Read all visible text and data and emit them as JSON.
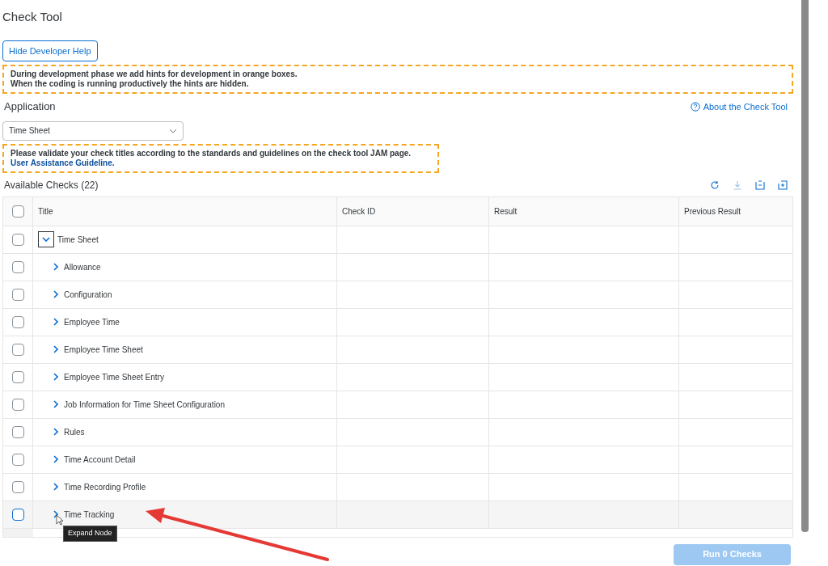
{
  "page_title": "Check Tool",
  "developer_help_button": "Hide Developer Help",
  "hints": [
    {
      "lines": [
        "During development phase we add hints for development in orange boxes.",
        "When the coding is running productively the hints are hidden."
      ]
    }
  ],
  "application": {
    "label": "Application",
    "value": "Time Sheet",
    "about_link": "About the Check Tool"
  },
  "guideline_hint": {
    "text": "Please validate your check titles according to the standards and guidelines on the check tool JAM page.",
    "link": "User Assistance Guideline."
  },
  "table": {
    "title": "Available Checks (22)",
    "select_all_checked": false,
    "columns": [
      "Title",
      "Check ID",
      "Result",
      "Previous Result"
    ],
    "rows": [
      {
        "title": "Time Sheet",
        "expanded": true,
        "checked": false,
        "hovered": false,
        "children": [
          {
            "title": "Allowance",
            "expanded": false,
            "checked": false,
            "hovered": false
          },
          {
            "title": "Configuration",
            "expanded": false,
            "checked": false,
            "hovered": false
          },
          {
            "title": "Employee Time",
            "expanded": false,
            "checked": false,
            "hovered": false
          },
          {
            "title": "Employee Time Sheet",
            "expanded": false,
            "checked": false,
            "hovered": false
          },
          {
            "title": "Employee Time Sheet Entry",
            "expanded": false,
            "checked": false,
            "hovered": false
          },
          {
            "title": "Job Information for Time Sheet Configuration",
            "expanded": false,
            "checked": false,
            "hovered": false
          },
          {
            "title": "Rules",
            "expanded": false,
            "checked": false,
            "hovered": false
          },
          {
            "title": "Time Account Detail",
            "expanded": false,
            "checked": false,
            "hovered": false
          },
          {
            "title": "Time Recording Profile",
            "expanded": false,
            "checked": false,
            "hovered": false
          },
          {
            "title": "Time Tracking",
            "expanded": false,
            "checked": false,
            "hovered": true
          }
        ]
      }
    ]
  },
  "tooltip": "Expand Node",
  "run_button": {
    "label": "Run 0 Checks",
    "disabled": true
  }
}
